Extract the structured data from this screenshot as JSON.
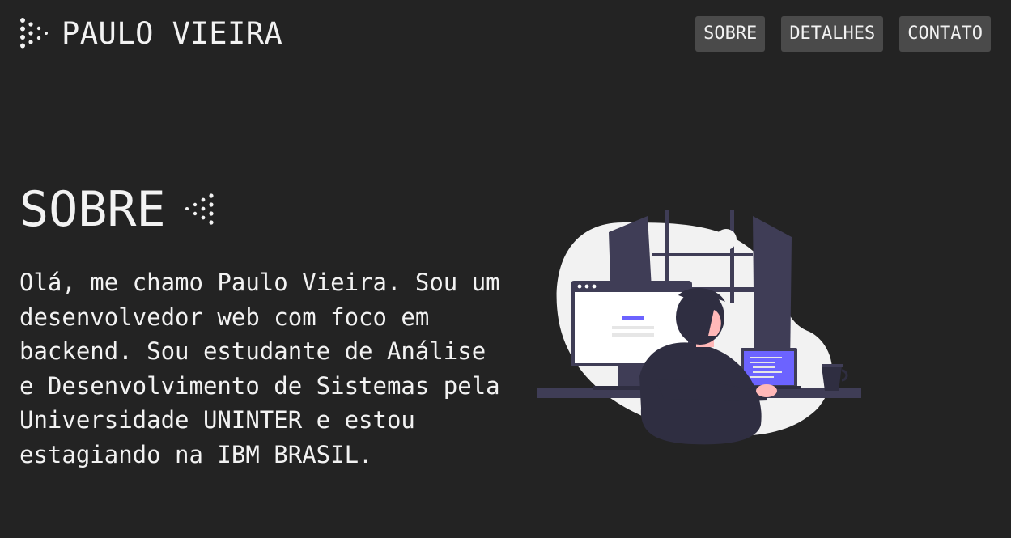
{
  "header": {
    "brand_logo_icon": "dot-arrow-logo-icon",
    "brand_title": "PAULO VIEIRA"
  },
  "nav": {
    "items": [
      {
        "label": "SOBRE"
      },
      {
        "label": "DETALHES"
      },
      {
        "label": "CONTATO"
      }
    ]
  },
  "about": {
    "title": "SOBRE",
    "title_icon": "dot-arrow-logo-icon",
    "text": "Olá, me chamo Paulo Vieira. Sou um desenvolvedor web com foco em backend. Sou estudante de Análise e Desenvolvimento de Sistemas pela Universidade UNINTER e estou estagiando na IBM BRASIL."
  },
  "illustration": {
    "name": "developer-at-desk-illustration",
    "colors": {
      "background": "#232323",
      "blob": "#f2f2f2",
      "dark": "#3f3d56",
      "shirt": "#2f2e41",
      "accent": "#6c63ff",
      "skin": "#ffb8b8"
    }
  },
  "colors": {
    "page_background": "#232323",
    "text": "#f2f2f2",
    "nav_button_background": "#4a4a4a"
  }
}
